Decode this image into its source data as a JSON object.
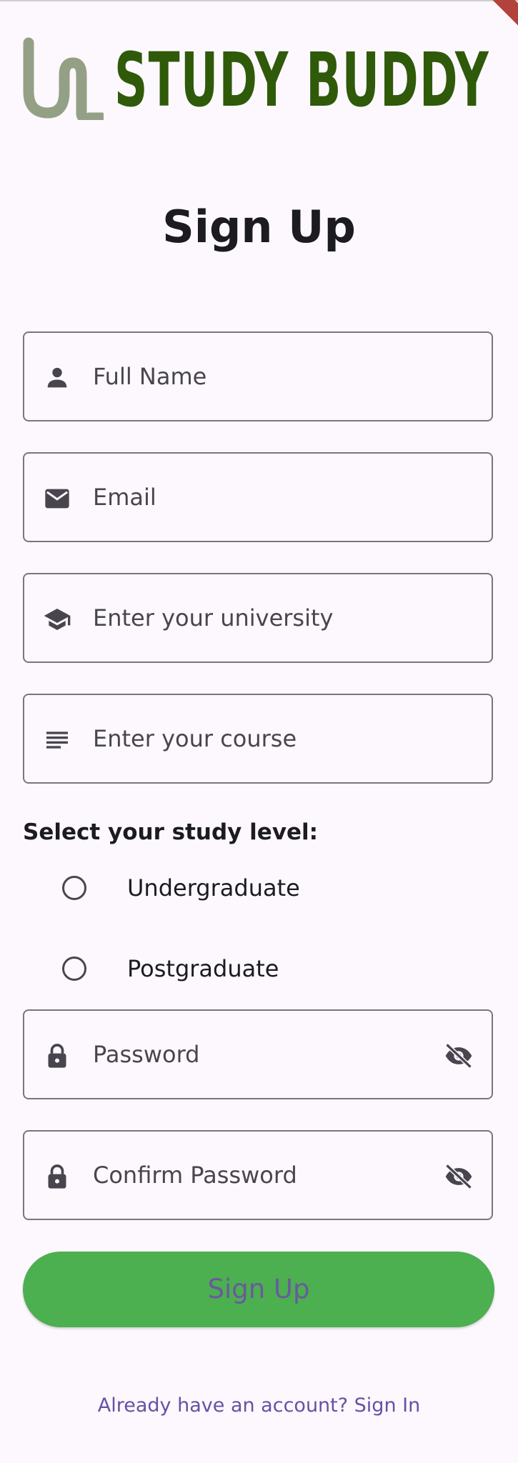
{
  "brand": {
    "logo_text": "STUDY BUDDY",
    "logo_text_color": "#2f5a0a",
    "logo_mark_color": "#93a085"
  },
  "page_title": "Sign Up",
  "fields": {
    "full_name": {
      "placeholder": "Full Name",
      "icon": "person-icon"
    },
    "email": {
      "placeholder": "Email",
      "icon": "mail-icon"
    },
    "university": {
      "placeholder": "Enter your university",
      "icon": "school-icon"
    },
    "course": {
      "placeholder": "Enter your course",
      "icon": "notes-icon"
    },
    "password": {
      "placeholder": "Password",
      "icon": "lock-icon",
      "toggle_icon": "visibility-off-icon"
    },
    "confirm_password": {
      "placeholder": "Confirm Password",
      "icon": "lock-icon",
      "toggle_icon": "visibility-off-icon"
    }
  },
  "study_level": {
    "label": "Select your study level:",
    "options": [
      {
        "label": "Undergraduate",
        "selected": false
      },
      {
        "label": "Postgraduate",
        "selected": false
      }
    ]
  },
  "submit_label": "Sign Up",
  "signin_prompt": "Already have an account? Sign In",
  "colors": {
    "background": "#fdf8fd",
    "button": "#4caf50",
    "button_text": "#6a5a9e",
    "link": "#6750a4",
    "outline": "#79767b"
  }
}
